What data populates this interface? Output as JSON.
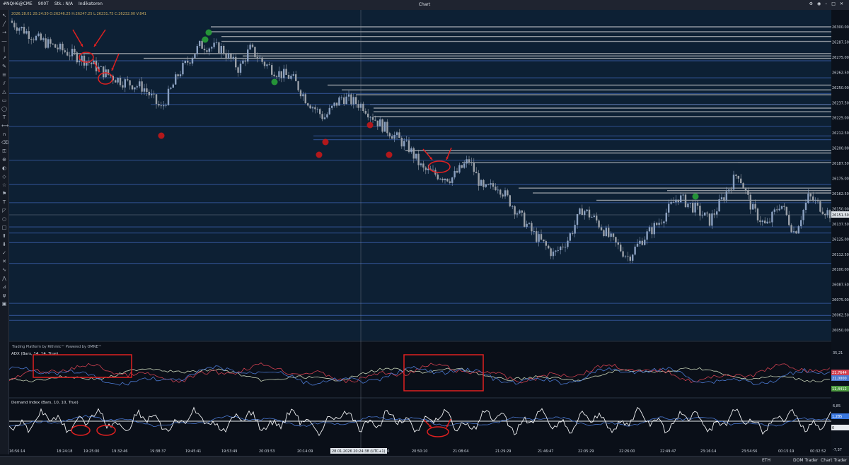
{
  "window": {
    "title": "Chart",
    "instrument": "#NQH6@CME",
    "bar_type": "900T",
    "stk": "Stk.: N/A",
    "indicators_label": "Indikatoren"
  },
  "ohlc_line": "2026.28.01 20:24:30 O:26246.25 H:26247.25 L:26231.75 C:26232.00 V:841",
  "price_axis": {
    "labels": [
      "26300.00",
      "26287.50",
      "26275.00",
      "26262.50",
      "26250.00",
      "26237.50",
      "26225.00",
      "26212.50",
      "26200.00",
      "26187.50",
      "26175.00",
      "26162.50",
      "26150.00",
      "26137.50",
      "26125.00",
      "26112.50",
      "26100.00",
      "26087.50",
      "26075.00",
      "26062.50",
      "26050.00"
    ],
    "current_price": "26151.50"
  },
  "time_axis": {
    "labels": [
      "16:56:14",
      "18:24:18",
      "19:25:00",
      "19:32:46",
      "19:38:37",
      "19:45:41",
      "19:53:49",
      "20:03:53",
      "20:14:09",
      "20:24:38",
      "20:36:50",
      "20:50:10",
      "21:08:04",
      "21:29:29",
      "21:46:47",
      "22:05:29",
      "22:26:00",
      "22:49:47",
      "23:16:14",
      "23:54:56",
      "00:15:19",
      "00:32:52"
    ],
    "crosshair_label": "28.01.2026 20:24:38 (UTC+1)"
  },
  "watermark": "Trading Platform by Rithmic™  Powered by OMNE™",
  "adx_panel": {
    "title": "ADX (Bars, 14, 14, True)",
    "axis_top": "35,21",
    "values": [
      "21,7644",
      "21,0000",
      "11,4412"
    ],
    "colors": {
      "adx": "#c8d4b8",
      "plus": "#d04050",
      "minus": "#4a78d0"
    }
  },
  "demand_panel": {
    "title": "Demand Index (Bars, 10, 10, True)",
    "axis_top": "6,85",
    "axis_bottom": "-7,37",
    "values": [
      "1,285",
      "0"
    ]
  },
  "statusbar": {
    "session": "ETH",
    "dom_trader": "DOM Trader",
    "chart_trader": "Chart Trader"
  },
  "colors": {
    "background": "#0a0f18",
    "bull_candle": "#8aa0c0",
    "bear_candle": "#9aa0a8",
    "level_gray": "#8f969e",
    "level_blue": "#2f4f8c",
    "annotation_red": "#e02020",
    "marker_red": "#d01818",
    "marker_green": "#2aa83a"
  }
}
